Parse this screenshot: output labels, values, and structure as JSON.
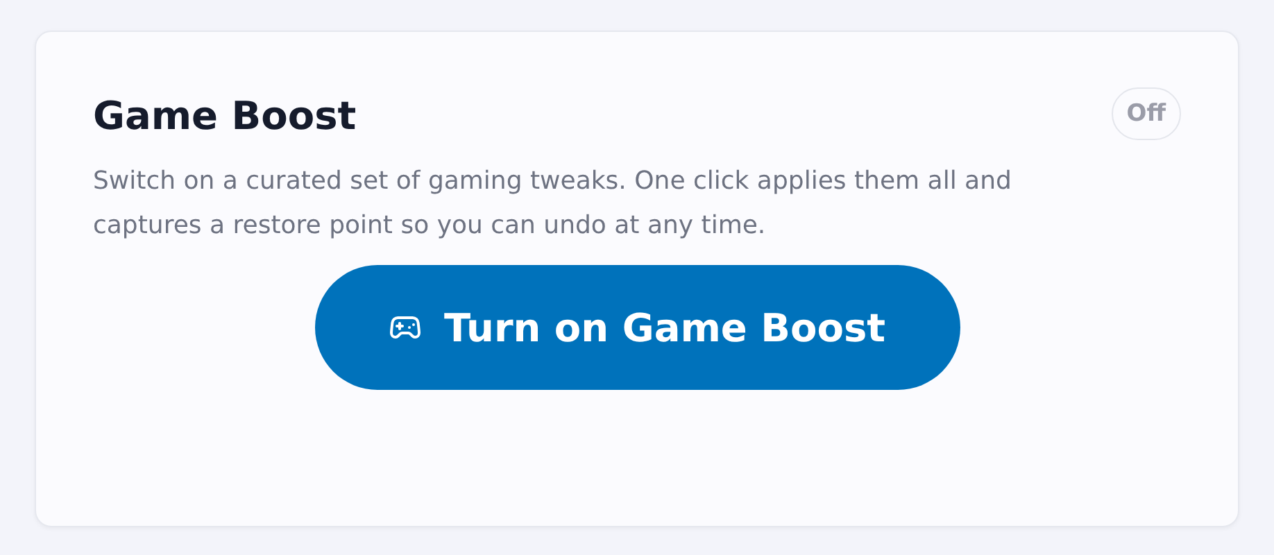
{
  "card": {
    "title": "Game Boost",
    "status": {
      "label": "Off",
      "on": false
    },
    "description": "Switch on a curated set of gaming tweaks. One click applies them all and captures a restore point so you can undo at any time.",
    "button": {
      "label": "Turn on Game Boost"
    }
  }
}
